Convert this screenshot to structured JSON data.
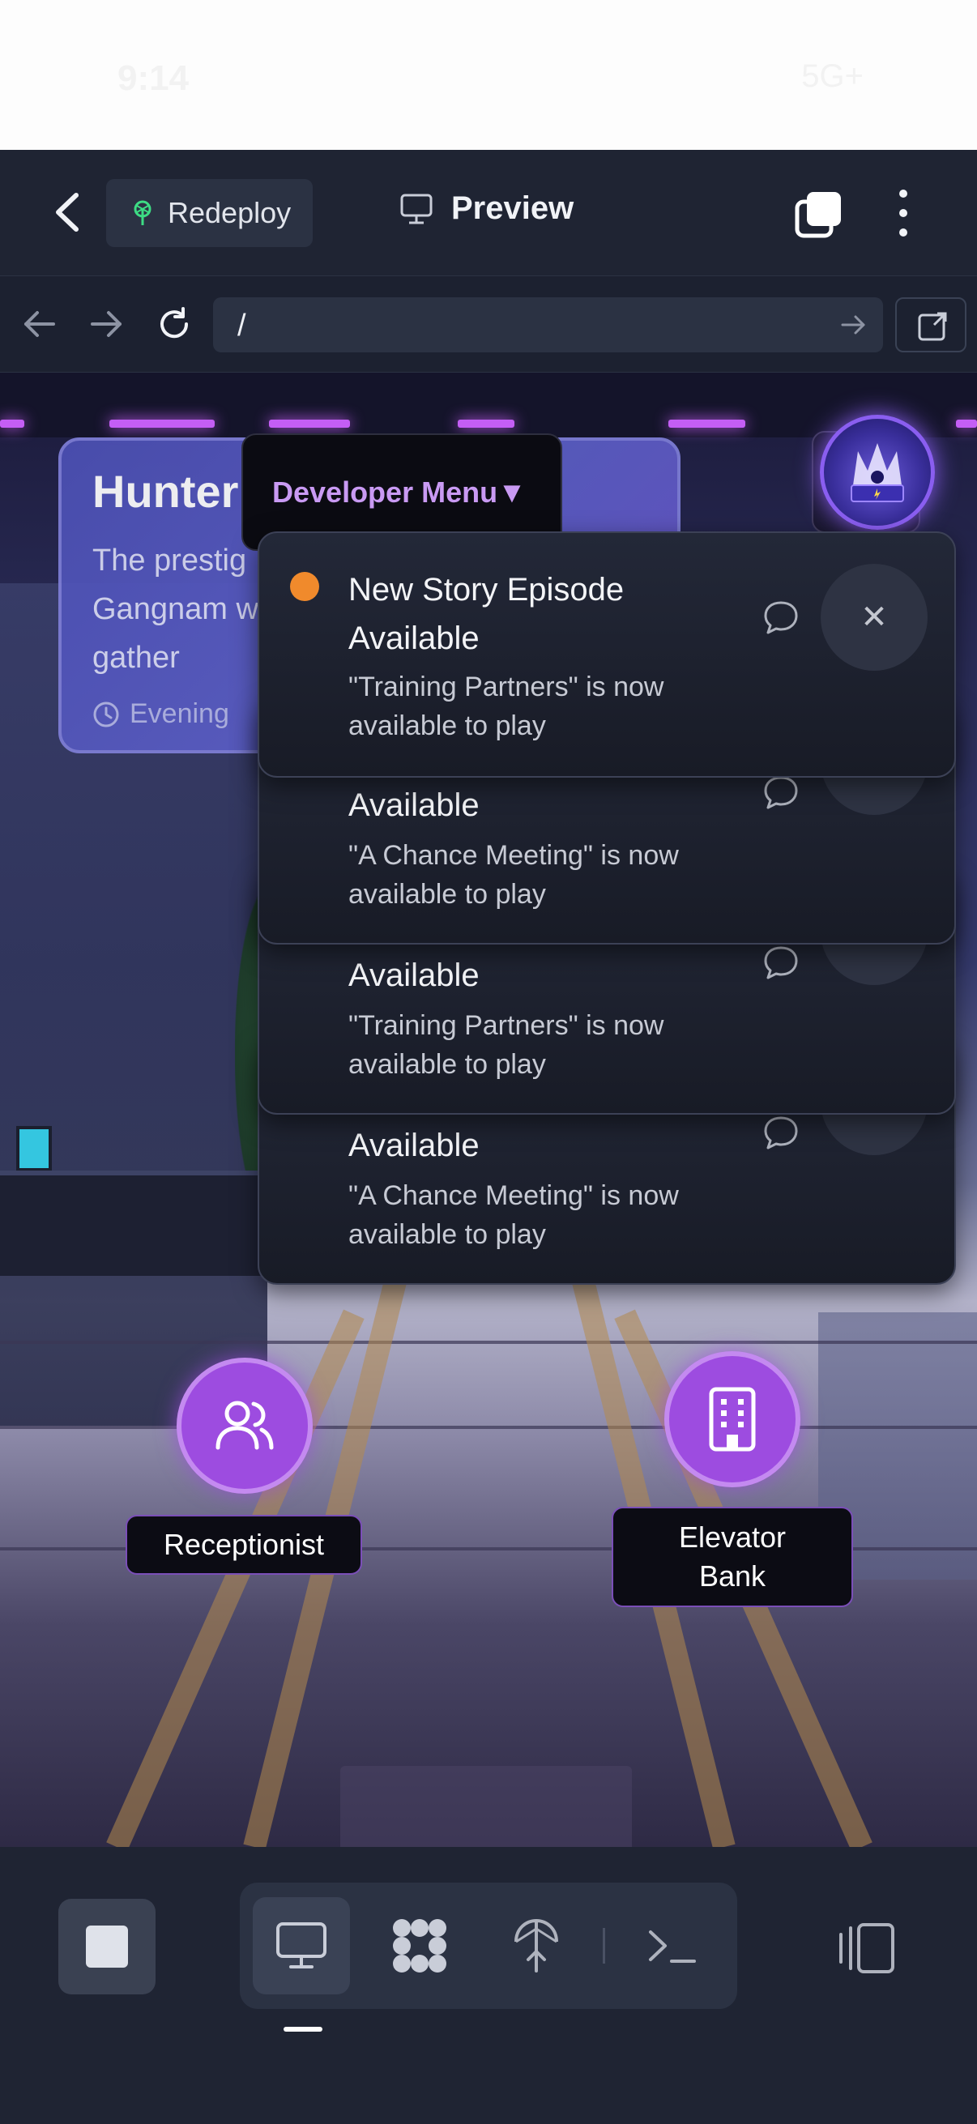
{
  "status_bar": {
    "time": "9:14",
    "signal": "5G+"
  },
  "header": {
    "redeploy_label": "Redeploy",
    "preview_label": "Preview"
  },
  "url_bar": {
    "path": "/"
  },
  "location_card": {
    "title": "Hunters HQ",
    "title_visible": "Hunter",
    "description": "The prestig Gangnam w gather",
    "time_of_day": "Evening"
  },
  "developer_menu": {
    "label": "Developer Menu▼"
  },
  "notifications": [
    {
      "title": "New Story Episode Available",
      "message": "\"Training Partners\" is now available to play",
      "unread": true
    },
    {
      "title": "Available",
      "message": "\"A Chance Meeting\" is now available to play",
      "unread": false
    },
    {
      "title": "Available",
      "message": "\"Training Partners\" is now available to play",
      "unread": false
    },
    {
      "title": "Available",
      "message": "\"A Chance Meeting\" is now available to play",
      "unread": false
    }
  ],
  "hotspots": [
    {
      "label": "Receptionist",
      "icon": "users-icon"
    },
    {
      "label": "Elevator Bank",
      "icon": "building-icon"
    }
  ],
  "colors": {
    "accent_purple": "#9d4ce0",
    "notification_dot": "#f08a2c",
    "card_blue": "#4c50b4",
    "dev_menu_text": "#c99af3",
    "chrome_bg": "#1f2433"
  }
}
